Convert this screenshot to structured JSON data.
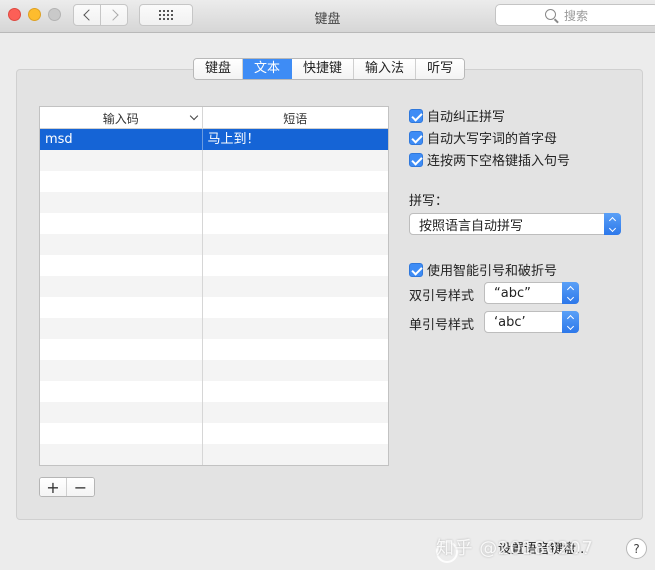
{
  "window": {
    "title": "键盘"
  },
  "search": {
    "placeholder": "搜索"
  },
  "tabs": [
    {
      "label": "键盘",
      "active": false
    },
    {
      "label": "文本",
      "active": true
    },
    {
      "label": "快捷键",
      "active": false
    },
    {
      "label": "输入法",
      "active": false
    },
    {
      "label": "听写",
      "active": false
    }
  ],
  "table": {
    "columns": [
      "输入码",
      "短语"
    ],
    "rows": [
      {
        "input": "msd",
        "phrase": "马上到！",
        "selected": true
      }
    ],
    "empty_rows": 15
  },
  "options": {
    "autocorrect": "自动纠正拼写",
    "autocap": "自动大写字词的首字母",
    "double_space": "连按两下空格键插入句号",
    "spelling_label": "拼写：",
    "spelling_value": "按照语言自动拼写",
    "smart_quotes": "使用智能引号和破折号",
    "double_quote_label": "双引号样式",
    "double_quote_value": "“abc”",
    "single_quote_label": "单引号样式",
    "single_quote_value": "‘abc’"
  },
  "buttons": {
    "add": "+",
    "remove": "−",
    "setup_keyboard": "设置语音键盘...",
    "help": "?"
  },
  "watermark": "知乎 @20180207",
  "colors": {
    "accent": "#3e8cf5",
    "selection": "#1564d6"
  }
}
